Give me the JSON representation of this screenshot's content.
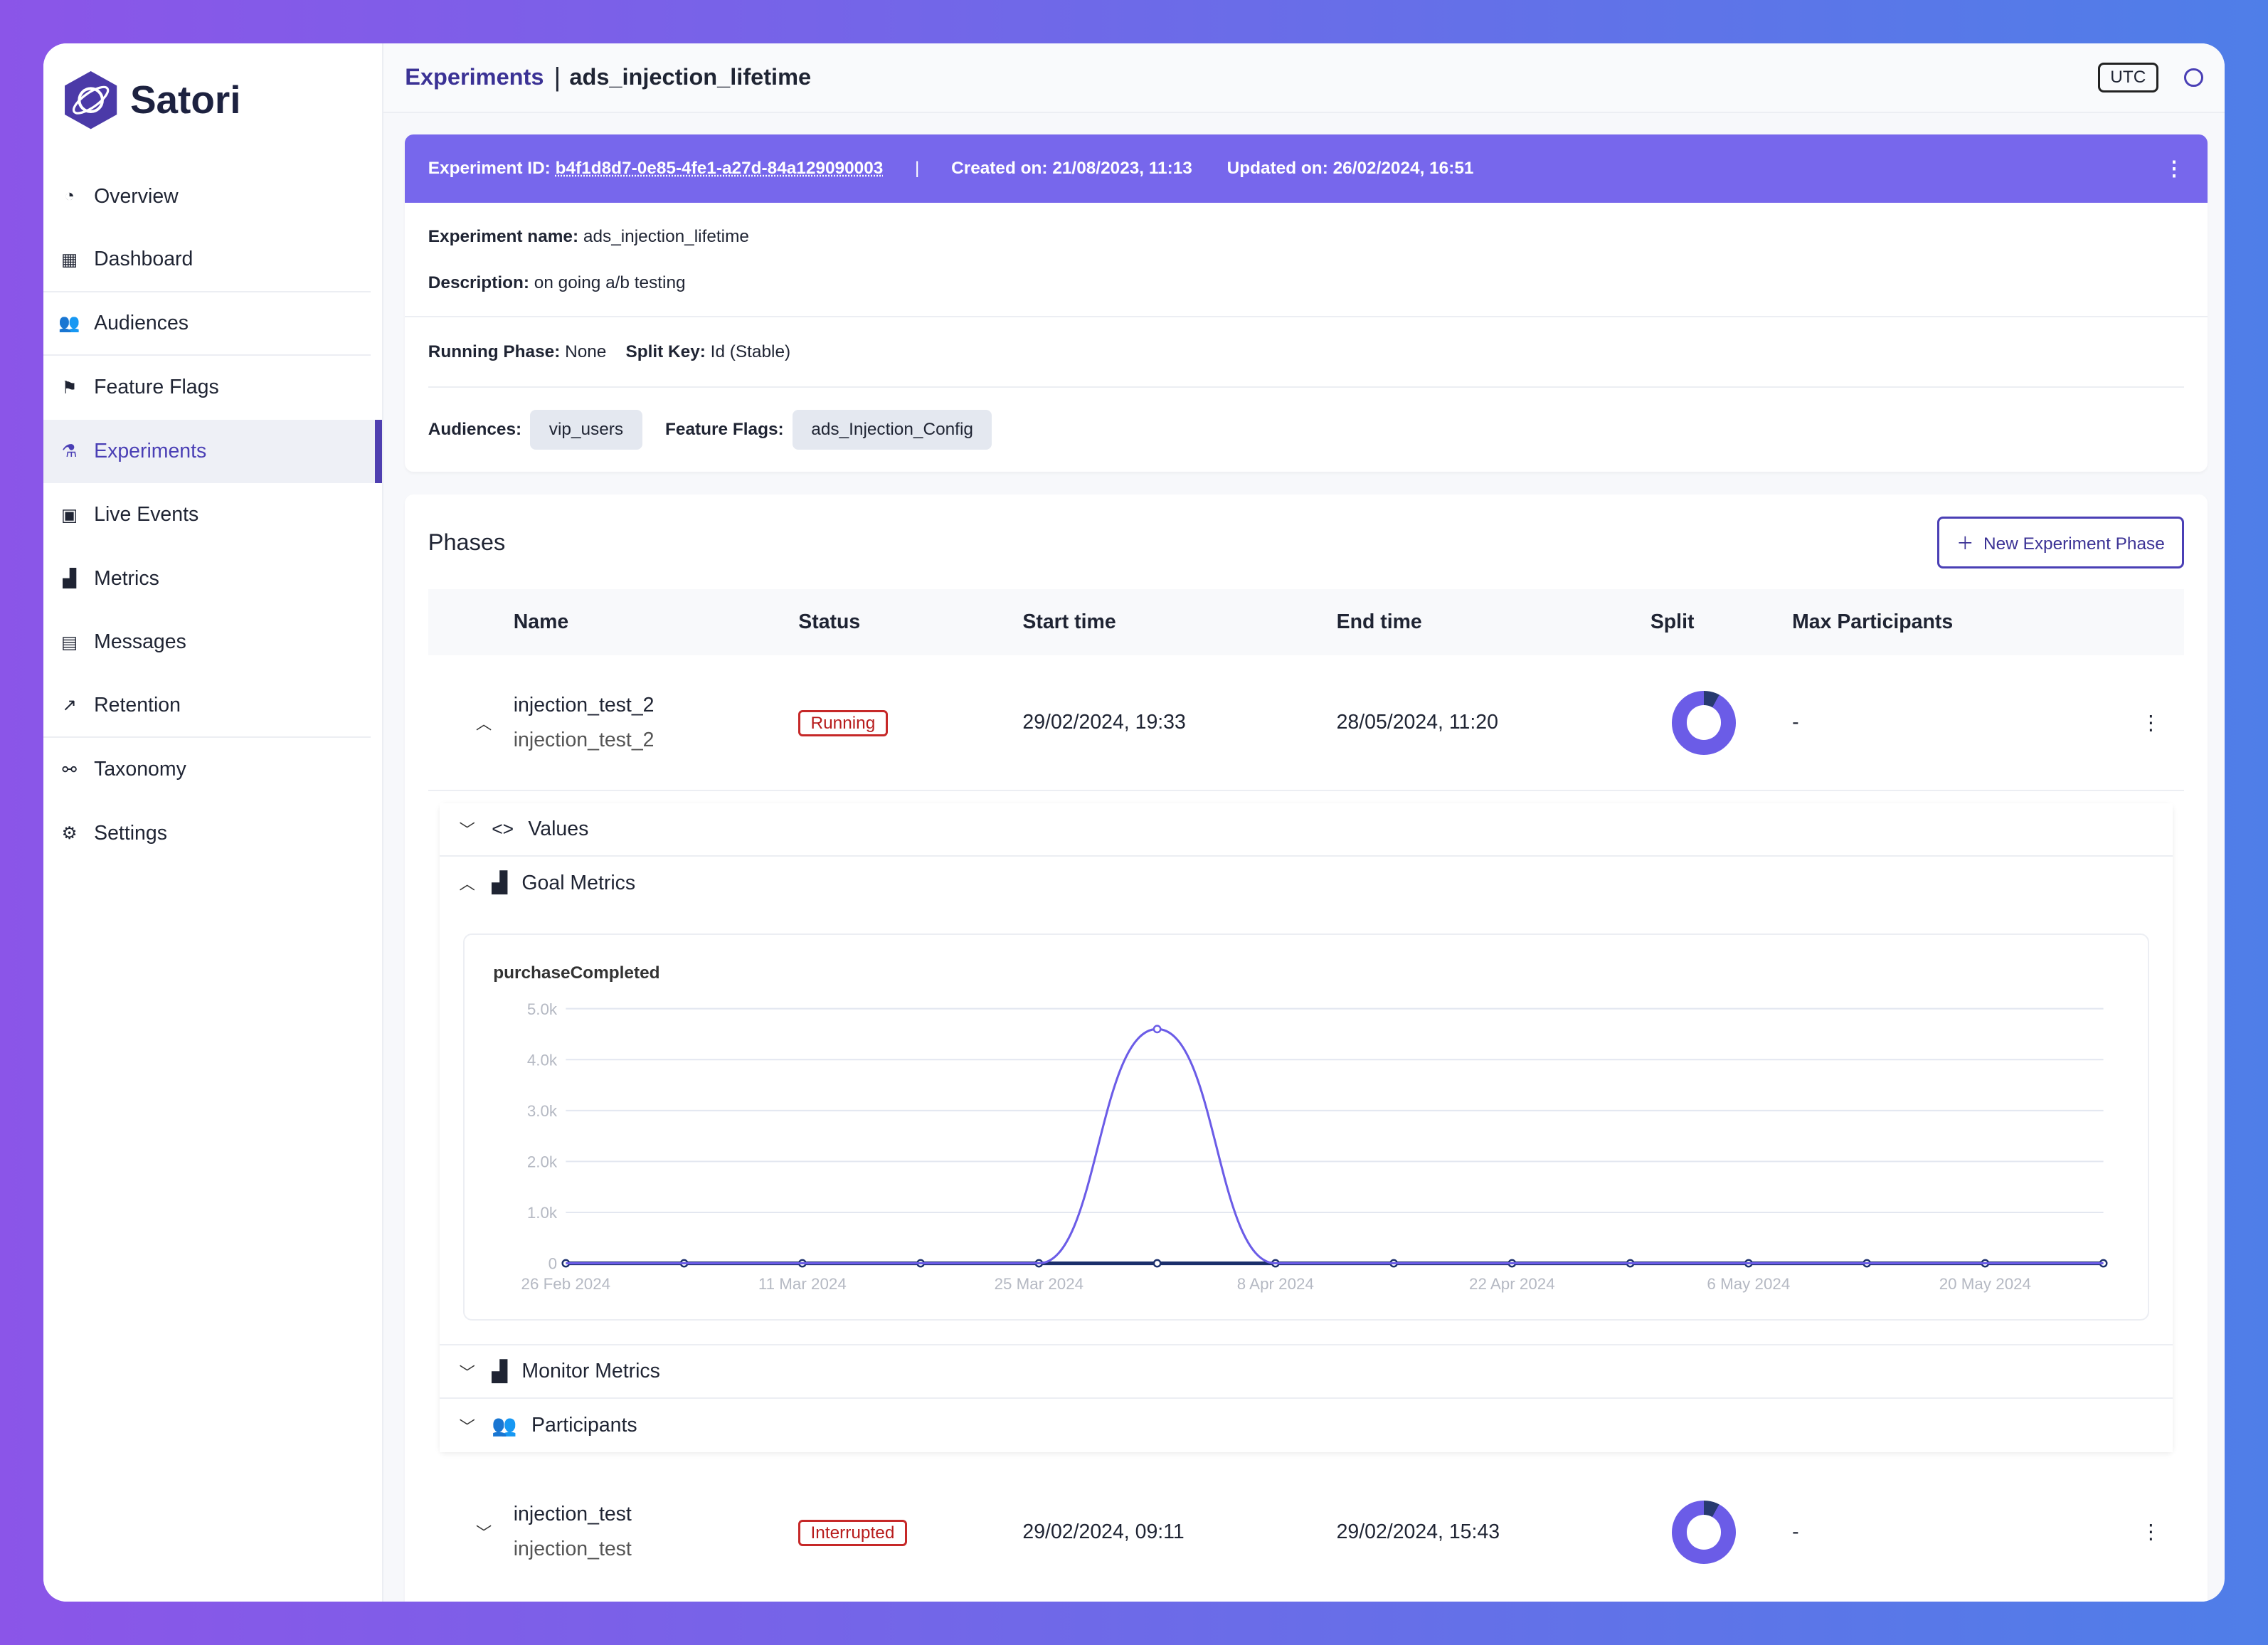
{
  "app": {
    "name": "Satori"
  },
  "sidebar": {
    "items": [
      {
        "label": "Overview",
        "icon": "gauge-icon"
      },
      {
        "label": "Dashboard",
        "icon": "dashboard-icon"
      },
      {
        "label": "Audiences",
        "icon": "users-icon"
      },
      {
        "label": "Feature Flags",
        "icon": "flag-icon"
      },
      {
        "label": "Experiments",
        "icon": "flask-icon",
        "active": true
      },
      {
        "label": "Live Events",
        "icon": "calendar-icon"
      },
      {
        "label": "Metrics",
        "icon": "bar-chart-icon"
      },
      {
        "label": "Messages",
        "icon": "message-icon"
      },
      {
        "label": "Retention",
        "icon": "retention-icon"
      },
      {
        "label": "Taxonomy",
        "icon": "taxonomy-icon"
      },
      {
        "label": "Settings",
        "icon": "gear-icon"
      }
    ]
  },
  "header": {
    "breadcrumb_root": "Experiments",
    "breadcrumb_current": "ads_injection_lifetime",
    "timezone": "UTC"
  },
  "experiment": {
    "id_label": "Experiment ID:",
    "id": "b4f1d8d7-0e85-4fe1-a27d-84a129090003",
    "created": "Created on: 21/08/2023, 11:13",
    "updated": "Updated on: 26/02/2024, 16:51",
    "name_label": "Experiment name:",
    "name": "ads_injection_lifetime",
    "desc_label": "Description:",
    "desc": "on going a/b testing",
    "phase_label": "Running Phase:",
    "phase": "None",
    "split_label": "Split Key:",
    "split": "Id (Stable)",
    "aud_label": "Audiences:",
    "audience": "vip_users",
    "ff_label": "Feature Flags:",
    "flag": "ads_Injection_Config",
    "accent": "#7767ec"
  },
  "phases": {
    "title": "Phases",
    "new_button": "New Experiment Phase",
    "columns": [
      "Name",
      "Status",
      "Start time",
      "End time",
      "Split",
      "Max Participants"
    ],
    "rows": [
      {
        "name": "injection_test_2",
        "sub": "injection_test_2",
        "status": "Running",
        "start": "29/02/2024, 19:33",
        "end": "28/05/2024, 11:20",
        "max": "-"
      },
      {
        "name": "injection_test",
        "sub": "injection_test",
        "status": "Interrupted",
        "start": "29/02/2024, 09:11",
        "end": "29/02/2024, 15:43",
        "max": "-"
      }
    ],
    "sections": {
      "values": "Values",
      "goal": "Goal Metrics",
      "monitor": "Monitor Metrics",
      "participants": "Participants"
    }
  },
  "chart_data": {
    "type": "line",
    "title": "purchaseCompleted",
    "x": [
      "26 Feb 2024",
      "4 Mar 2024",
      "11 Mar 2024",
      "18 Mar 2024",
      "25 Mar 2024",
      "1 Apr 2024",
      "8 Apr 2024",
      "15 Apr 2024",
      "22 Apr 2024",
      "29 Apr 2024",
      "6 May 2024",
      "13 May 2024",
      "20 May 2024",
      "27 May 2024"
    ],
    "xticks": [
      "26 Feb 2024",
      "11 Mar 2024",
      "25 Mar 2024",
      "8 Apr 2024",
      "22 Apr 2024",
      "6 May 2024",
      "20 May 2024"
    ],
    "yticks": [
      "0",
      "1.0k",
      "2.0k",
      "3.0k",
      "4.0k",
      "5.0k"
    ],
    "ylim": [
      0,
      5000
    ],
    "grid": true,
    "series": [
      {
        "color": "#6b5ce7",
        "values": [
          0,
          0,
          0,
          0,
          0,
          4600,
          0,
          0,
          0,
          0,
          0,
          0,
          0,
          0
        ]
      },
      {
        "color": "#1b2f6b",
        "values": [
          0,
          0,
          0,
          0,
          0,
          0,
          0,
          0,
          0,
          0,
          0,
          0,
          0,
          0
        ]
      }
    ]
  }
}
